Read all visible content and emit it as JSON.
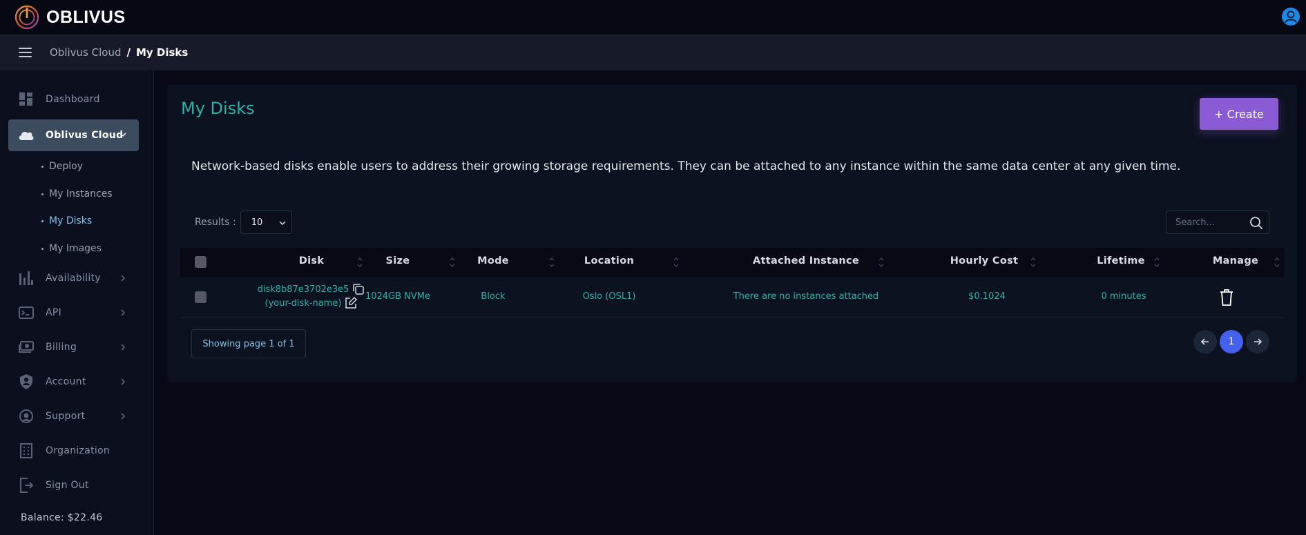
{
  "app": {
    "name": "OBLIVUS"
  },
  "breadcrumb": {
    "parent": "Oblivus Cloud",
    "separator": "/",
    "current": "My Disks"
  },
  "sidebar": {
    "items": [
      {
        "label": "Dashboard",
        "icon": "dashboard-icon"
      },
      {
        "label": "Oblivus Cloud",
        "icon": "cloud-icon",
        "expanded": true
      },
      {
        "label": "Availability",
        "icon": "bar-chart-icon"
      },
      {
        "label": "API",
        "icon": "terminal-icon"
      },
      {
        "label": "Billing",
        "icon": "money-icon"
      },
      {
        "label": "Account",
        "icon": "shield-user-icon"
      },
      {
        "label": "Support",
        "icon": "support-icon"
      },
      {
        "label": "Organization",
        "icon": "building-icon"
      },
      {
        "label": "Sign Out",
        "icon": "sign-out-icon"
      }
    ],
    "subitems": [
      "Deploy",
      "My Instances",
      "My Disks",
      "My Images"
    ],
    "current_subitem": "My Disks",
    "balance": "Balance: $22.46"
  },
  "main": {
    "title": "My Disks",
    "create_label": "+ Create",
    "description": "Network-based disks enable users to address their growing storage requirements. They can be attached to any instance within the same data center at any given time.",
    "results_label": "Results :",
    "results_value": "10",
    "search_placeholder": "Search..."
  },
  "table": {
    "columns": [
      "Disk",
      "Size",
      "Mode",
      "Location",
      "Attached Instance",
      "Hourly Cost",
      "Lifetime",
      "Manage"
    ],
    "rows": [
      {
        "disk_id": "disk8b87e3702e3e5",
        "disk_name": "(your-disk-name)",
        "size": "1024GB NVMe",
        "mode": "Block",
        "location": "Oslo (OSL1)",
        "attached_instance": "There are no instances attached",
        "hourly_cost": "$0.1024",
        "lifetime": "0 minutes"
      }
    ]
  },
  "pagination": {
    "info": "Showing page 1 of 1",
    "current_page": "1"
  },
  "colors": {
    "accent": "#2bb3a8",
    "create_button": "#8a5bd5",
    "pager_active": "#4361ee",
    "link": "#7fc4e6"
  }
}
